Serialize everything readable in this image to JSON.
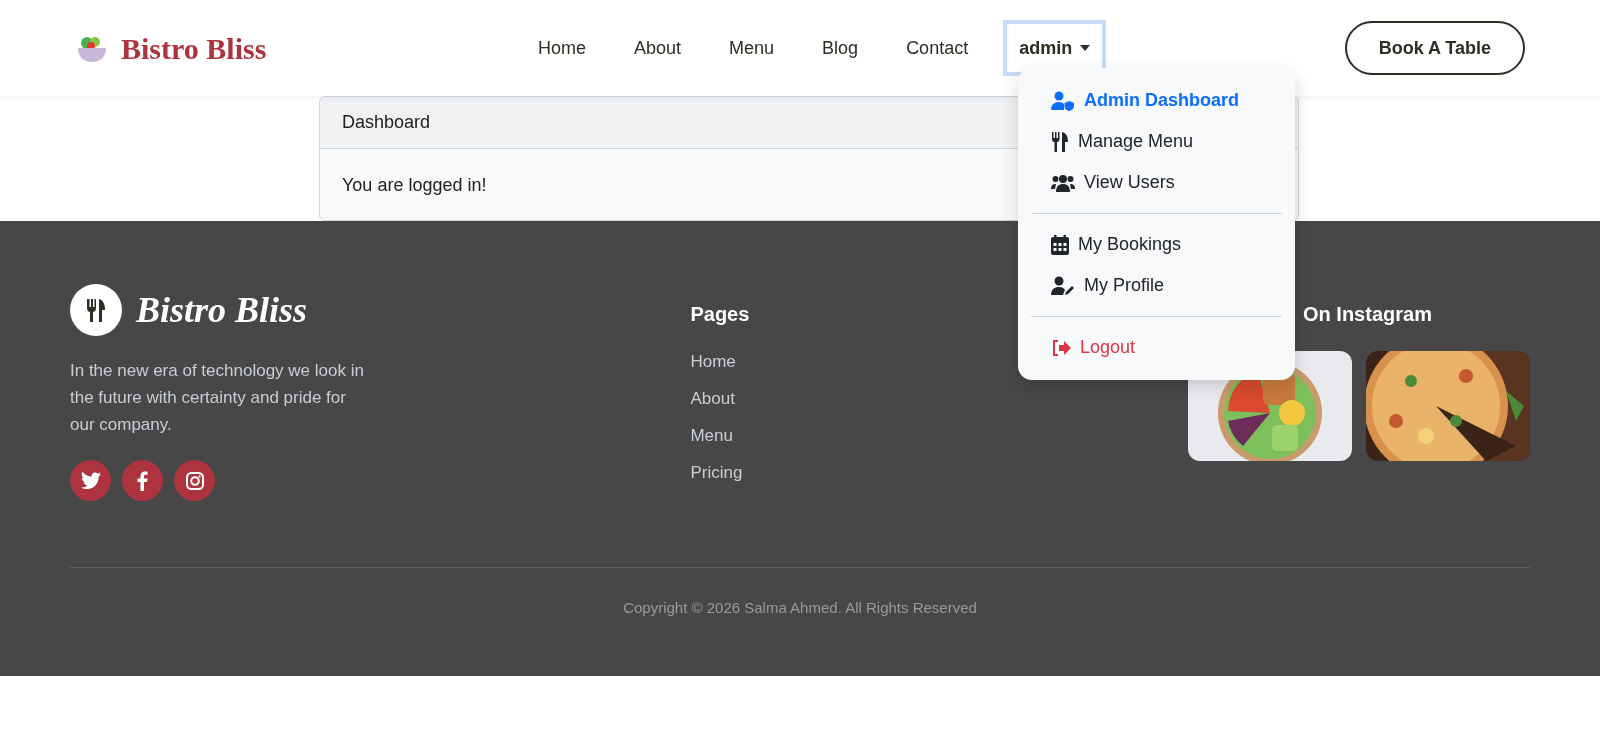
{
  "brand": "Bistro Bliss",
  "nav": [
    {
      "label": "Home"
    },
    {
      "label": "About"
    },
    {
      "label": "Menu"
    },
    {
      "label": "Blog"
    },
    {
      "label": "Contact"
    }
  ],
  "user_menu": {
    "label": "admin",
    "expanded": true,
    "items": [
      {
        "kind": "item",
        "label": "Admin Dashboard",
        "selected": true
      },
      {
        "kind": "item",
        "label": "Manage Menu",
        "selected": false
      },
      {
        "kind": "item",
        "label": "View Users",
        "selected": false
      },
      {
        "kind": "divider"
      },
      {
        "kind": "item",
        "label": "My Bookings",
        "selected": false
      },
      {
        "kind": "item",
        "label": "My Profile",
        "selected": false
      },
      {
        "kind": "divider"
      },
      {
        "kind": "danger",
        "label": "Logout"
      }
    ]
  },
  "cta": "Book A Table",
  "card": {
    "header": "Dashboard",
    "body": "You are logged in!"
  },
  "footer": {
    "brand": "Bistro Bliss",
    "description": "In the new era of technology we look in the future with certainty and pride for our company.",
    "pages_title": "Pages",
    "pages": [
      "Home",
      "About",
      "Menu",
      "Pricing"
    ],
    "instagram_title": "On Instagram",
    "instagram": [
      {
        "kind": "picture"
      },
      {
        "kind": "picture"
      }
    ],
    "copyright": "Copyright © 2026 Salma Ahmed. All Rights Reserved"
  }
}
